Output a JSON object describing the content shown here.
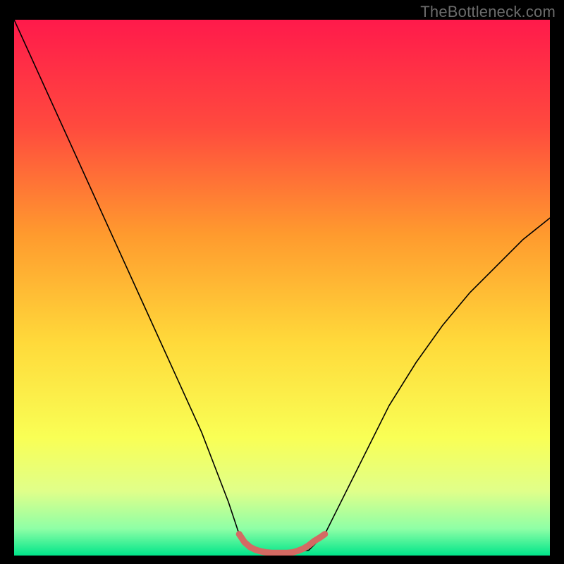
{
  "watermark": "TheBottleneck.com",
  "chart_data": {
    "type": "line",
    "title": "",
    "xlabel": "",
    "ylabel": "",
    "xlim": [
      0,
      100
    ],
    "ylim": [
      0,
      100
    ],
    "background_gradient": [
      {
        "stop": 0.0,
        "color": "#ff1a4b"
      },
      {
        "stop": 0.2,
        "color": "#ff4a3e"
      },
      {
        "stop": 0.4,
        "color": "#ff9a2e"
      },
      {
        "stop": 0.6,
        "color": "#ffd93a"
      },
      {
        "stop": 0.78,
        "color": "#f9ff55"
      },
      {
        "stop": 0.88,
        "color": "#e0ff8a"
      },
      {
        "stop": 0.95,
        "color": "#8effa6"
      },
      {
        "stop": 1.0,
        "color": "#00e58a"
      }
    ],
    "series": [
      {
        "name": "bottleneck-curve",
        "color": "#000000",
        "width": 1.6,
        "x": [
          0,
          5,
          10,
          15,
          20,
          25,
          30,
          35,
          40,
          42,
          45,
          50,
          55,
          58,
          60,
          65,
          70,
          75,
          80,
          85,
          90,
          95,
          100
        ],
        "y": [
          100,
          89,
          78,
          67,
          56,
          45,
          34,
          23,
          10,
          4,
          1,
          0.5,
          1,
          4,
          8,
          18,
          28,
          36,
          43,
          49,
          54,
          59,
          63
        ]
      },
      {
        "name": "optimal-zone",
        "color": "#d46a63",
        "width": 9,
        "x": [
          42,
          43,
          44,
          45,
          46,
          47,
          48,
          49,
          50,
          51,
          52,
          53,
          54,
          55,
          56,
          57,
          58
        ],
        "y": [
          4,
          2.5,
          1.6,
          1.1,
          0.8,
          0.6,
          0.5,
          0.5,
          0.5,
          0.5,
          0.6,
          0.9,
          1.3,
          1.9,
          2.7,
          3.3,
          4
        ]
      }
    ]
  }
}
